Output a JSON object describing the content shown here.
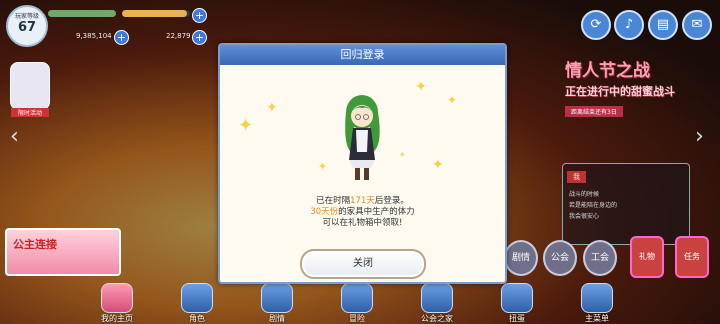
{
  "status": {
    "rank_label": "玩家等级",
    "rank_value": "67",
    "currency1": "9,385,104",
    "currency2": "22,879"
  },
  "event": {
    "title": "情人节之战",
    "subtitle": "正在进行中的甜蜜战斗",
    "note": "距离结束还有3日"
  },
  "chat": {
    "name": "我",
    "lines": [
      "战斗的时候",
      "若是能陪在身边的",
      "我会很安心"
    ]
  },
  "left_avatar": {
    "tag": "限时活动"
  },
  "left_banner": {
    "label": "公主连接"
  },
  "side_buttons": [
    "剧情",
    "公会",
    "工会",
    "礼物",
    "任务"
  ],
  "nav": {
    "items": [
      "我的主页",
      "角色",
      "剧情",
      "冒险",
      "公会之家",
      "扭蛋",
      "主菜单"
    ]
  },
  "dialog": {
    "title": "回归登录",
    "line1_prefix": "已在时隔",
    "days": "171天",
    "line1_suffix": "后登录。",
    "line2_highlight": "30天份",
    "line2_rest": "的家具中生产的体力",
    "line3": "可以在礼物箱中领取!",
    "close_label": "关闭"
  }
}
